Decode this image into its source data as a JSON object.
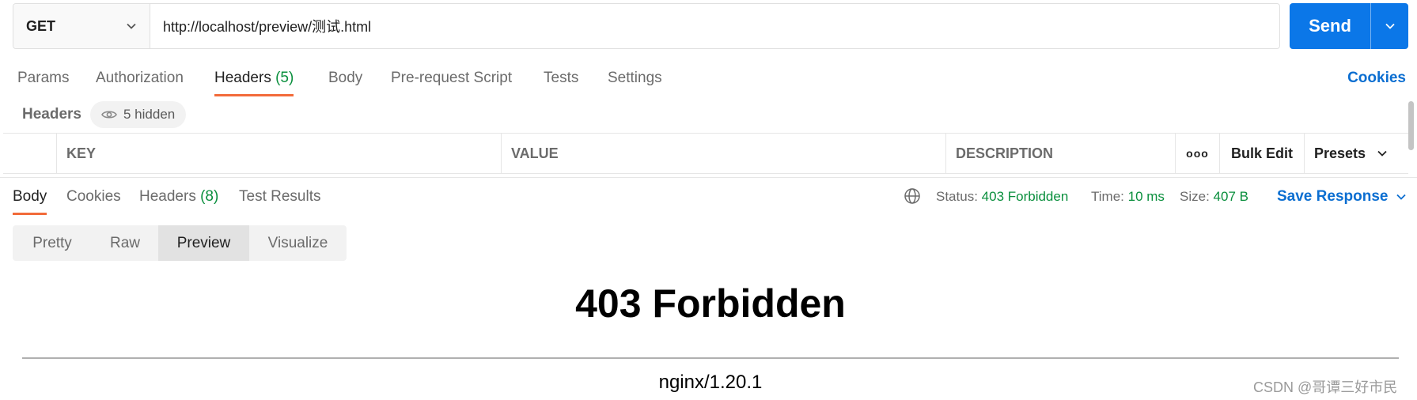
{
  "request": {
    "method": "GET",
    "url": "http://localhost/preview/测试.html",
    "send_label": "Send"
  },
  "request_tabs": [
    {
      "label": "Params"
    },
    {
      "label": "Authorization"
    },
    {
      "label": "Headers",
      "count": "(5)"
    },
    {
      "label": "Body"
    },
    {
      "label": "Pre-request Script"
    },
    {
      "label": "Tests"
    },
    {
      "label": "Settings"
    }
  ],
  "cookies_link": "Cookies",
  "headers_section": {
    "label": "Headers",
    "hidden_text": "5 hidden",
    "columns": {
      "key": "KEY",
      "value": "VALUE",
      "description": "DESCRIPTION",
      "more": "ooo",
      "bulk_edit": "Bulk Edit",
      "presets": "Presets"
    }
  },
  "response_tabs": [
    {
      "label": "Body"
    },
    {
      "label": "Cookies"
    },
    {
      "label": "Headers",
      "count": "(8)"
    },
    {
      "label": "Test Results"
    }
  ],
  "response_status": {
    "status_label": "Status:",
    "status_value": "403 Forbidden",
    "time_label": "Time:",
    "time_value": "10 ms",
    "size_label": "Size:",
    "size_value": "407 B",
    "save_label": "Save Response"
  },
  "view_modes": [
    "Pretty",
    "Raw",
    "Preview",
    "Visualize"
  ],
  "preview": {
    "title": "403 Forbidden",
    "server": "nginx/1.20.1"
  },
  "watermark": "CSDN @哥谭三好市民",
  "colors": {
    "accent_blue": "#0b77e8",
    "tab_underline": "#f26b3a",
    "status_green": "#0a8f3d",
    "link_blue": "#0b6ed1"
  }
}
